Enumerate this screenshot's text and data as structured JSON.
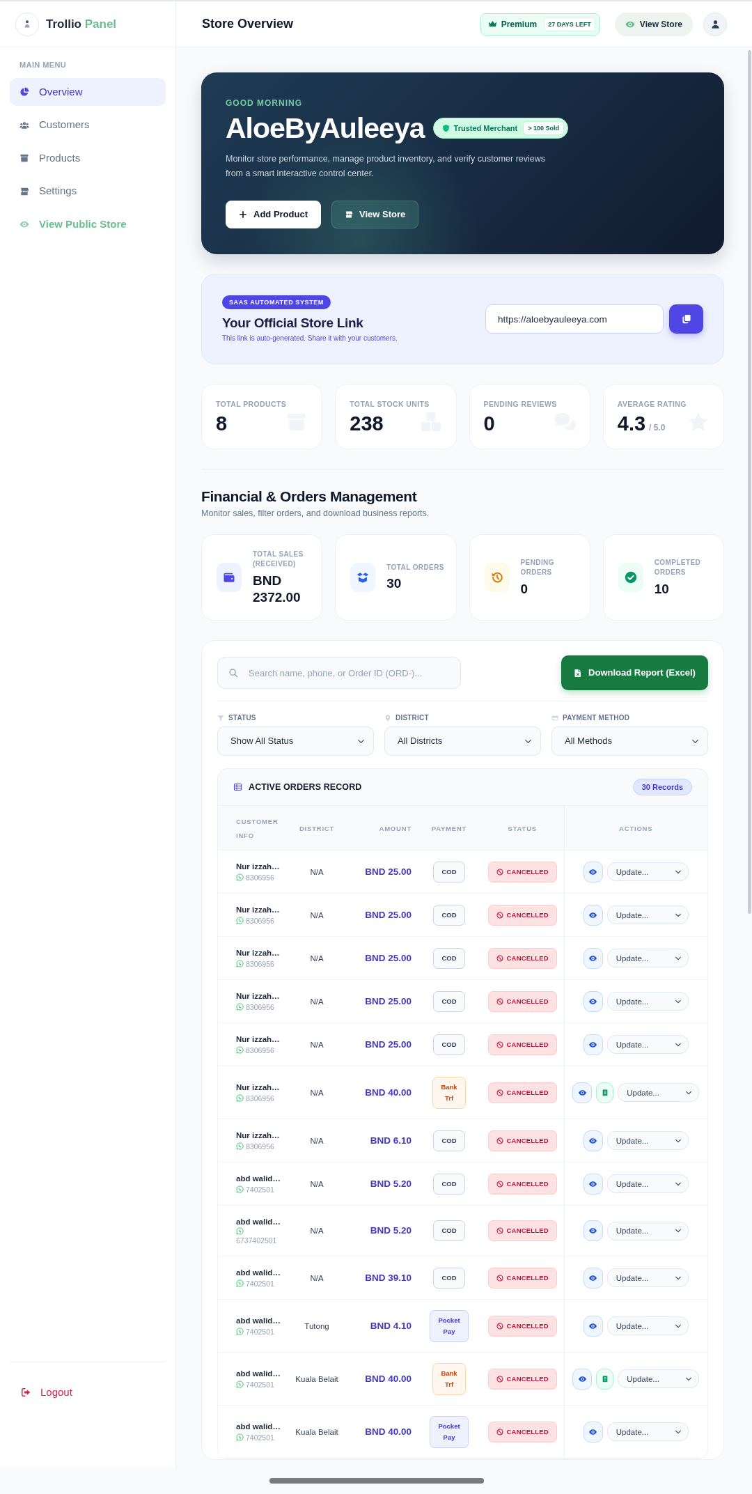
{
  "sidebar": {
    "brand": {
      "name": "Trollio",
      "accent": "Panel"
    },
    "section_label": "MAIN MENU",
    "items": [
      {
        "label": "Overview",
        "kind": "page",
        "selected": true
      },
      {
        "label": "Customers",
        "kind": "page",
        "selected": false
      },
      {
        "label": "Products",
        "kind": "page",
        "selected": false
      },
      {
        "label": "Settings",
        "kind": "page",
        "selected": false
      },
      {
        "label": "View Public Store",
        "kind": "link",
        "selected": false
      }
    ],
    "logout": "Logout"
  },
  "topbar": {
    "title": "Store Overview",
    "plan": {
      "label": "Premium",
      "days_left": "27 DAYS LEFT"
    },
    "view_store_button": "View Store"
  },
  "hero": {
    "greeting": "GOOD MORNING",
    "store_name": "AloeByAuleeya",
    "trust_badge": {
      "label": "Trusted Merchant",
      "sold": "> 100 Sold"
    },
    "description": "Monitor store performance, manage product inventory, and verify customer reviews from a smart interactive control center.",
    "buttons": [
      {
        "label": "Add Product",
        "kind": "primary"
      },
      {
        "label": "View Store",
        "kind": "secondary"
      }
    ]
  },
  "store_link": {
    "badge": "SAAS AUTOMATED SYSTEM",
    "title": "Your Official Store Link",
    "hint": "This link is auto-generated. Share it with your customers.",
    "url": "https://aloebyauleeya.com"
  },
  "store_stats": [
    {
      "label": "TOTAL PRODUCTS",
      "value": "8"
    },
    {
      "label": "TOTAL STOCK UNITS",
      "value": "238"
    },
    {
      "label": "PENDING REVIEWS",
      "value": "0"
    },
    {
      "label": "AVERAGE RATING",
      "value": "4.3",
      "suffix": "/ 5.0"
    }
  ],
  "finance": {
    "title": "Financial & Orders Management",
    "subtitle": "Monitor sales, filter orders, and download business reports.",
    "cards": [
      {
        "label": "TOTAL SALES (RECEIVED)",
        "value": "BND 2372.00"
      },
      {
        "label": "TOTAL ORDERS",
        "value": "30"
      },
      {
        "label": "PENDING ORDERS",
        "value": "0"
      },
      {
        "label": "COMPLETED ORDERS",
        "value": "10"
      }
    ]
  },
  "orders": {
    "search": {
      "placeholder": "Search name, phone, or Order ID (ORD-)..."
    },
    "download_button": "Download Report (Excel)",
    "filters": [
      {
        "label": "STATUS",
        "value": "Show All Status"
      },
      {
        "label": "DISTRICT",
        "value": "All Districts"
      },
      {
        "label": "PAYMENT METHOD",
        "value": "All Methods"
      }
    ],
    "table": {
      "title": "ACTIVE ORDERS RECORD",
      "count": "30 Records",
      "columns": [
        "CUSTOMER INFO",
        "DISTRICT",
        "AMOUNT",
        "PAYMENT",
        "STATUS",
        "ACTIONS"
      ],
      "rows": [
        {
          "name": "Nur izzah…",
          "phone": "8306956",
          "district": "N/A",
          "amount": "BND 25.00",
          "payment": {
            "label": "COD",
            "kind": "cod"
          },
          "status": {
            "label": "CANCELLED",
            "kind": "cancelled"
          },
          "receipt": false,
          "action": "Update..."
        },
        {
          "name": "Nur izzah…",
          "phone": "8306956",
          "district": "N/A",
          "amount": "BND 25.00",
          "payment": {
            "label": "COD",
            "kind": "cod"
          },
          "status": {
            "label": "CANCELLED",
            "kind": "cancelled"
          },
          "receipt": false,
          "action": "Update..."
        },
        {
          "name": "Nur izzah…",
          "phone": "8306956",
          "district": "N/A",
          "amount": "BND 25.00",
          "payment": {
            "label": "COD",
            "kind": "cod"
          },
          "status": {
            "label": "CANCELLED",
            "kind": "cancelled"
          },
          "receipt": false,
          "action": "Update..."
        },
        {
          "name": "Nur izzah…",
          "phone": "8306956",
          "district": "N/A",
          "amount": "BND 25.00",
          "payment": {
            "label": "COD",
            "kind": "cod"
          },
          "status": {
            "label": "CANCELLED",
            "kind": "cancelled"
          },
          "receipt": false,
          "action": "Update..."
        },
        {
          "name": "Nur izzah…",
          "phone": "8306956",
          "district": "N/A",
          "amount": "BND 25.00",
          "payment": {
            "label": "COD",
            "kind": "cod"
          },
          "status": {
            "label": "CANCELLED",
            "kind": "cancelled"
          },
          "receipt": false,
          "action": "Update..."
        },
        {
          "name": "Nur izzah…",
          "phone": "8306956",
          "district": "N/A",
          "amount": "BND 40.00",
          "payment": {
            "label": "Bank Trf",
            "kind": "bank"
          },
          "status": {
            "label": "CANCELLED",
            "kind": "cancelled"
          },
          "receipt": true,
          "action": "Update..."
        },
        {
          "name": "Nur izzah…",
          "phone": "8306956",
          "district": "N/A",
          "amount": "BND 6.10",
          "payment": {
            "label": "COD",
            "kind": "cod"
          },
          "status": {
            "label": "CANCELLED",
            "kind": "cancelled"
          },
          "receipt": false,
          "action": "Update..."
        },
        {
          "name": "abd walid…",
          "phone": "7402501",
          "district": "N/A",
          "amount": "BND 5.20",
          "payment": {
            "label": "COD",
            "kind": "cod"
          },
          "status": {
            "label": "CANCELLED",
            "kind": "cancelled"
          },
          "receipt": false,
          "action": "Update..."
        },
        {
          "name": "abd walid…",
          "phone": "6737402501",
          "district": "N/A",
          "amount": "BND 5.20",
          "payment": {
            "label": "COD",
            "kind": "cod"
          },
          "status": {
            "label": "CANCELLED",
            "kind": "cancelled"
          },
          "receipt": false,
          "action": "Update..."
        },
        {
          "name": "abd walid…",
          "phone": "7402501",
          "district": "N/A",
          "amount": "BND 39.10",
          "payment": {
            "label": "COD",
            "kind": "cod"
          },
          "status": {
            "label": "CANCELLED",
            "kind": "cancelled"
          },
          "receipt": false,
          "action": "Update..."
        },
        {
          "name": "abd walid…",
          "phone": "7402501",
          "district": "Tutong",
          "amount": "BND 4.10",
          "payment": {
            "label": "Pocket Pay",
            "kind": "pocket"
          },
          "status": {
            "label": "CANCELLED",
            "kind": "cancelled"
          },
          "receipt": false,
          "action": "Update..."
        },
        {
          "name": "abd walid…",
          "phone": "7402501",
          "district": "Kuala Belait",
          "amount": "BND 40.00",
          "payment": {
            "label": "Bank Trf",
            "kind": "bank"
          },
          "status": {
            "label": "CANCELLED",
            "kind": "cancelled"
          },
          "receipt": true,
          "action": "Update..."
        },
        {
          "name": "abd walid…",
          "phone": "7402501",
          "district": "Kuala Belait",
          "amount": "BND 40.00",
          "payment": {
            "label": "Pocket Pay",
            "kind": "pocket"
          },
          "status": {
            "label": "CANCELLED",
            "kind": "cancelled"
          },
          "receipt": false,
          "action": "Update..."
        }
      ]
    }
  }
}
